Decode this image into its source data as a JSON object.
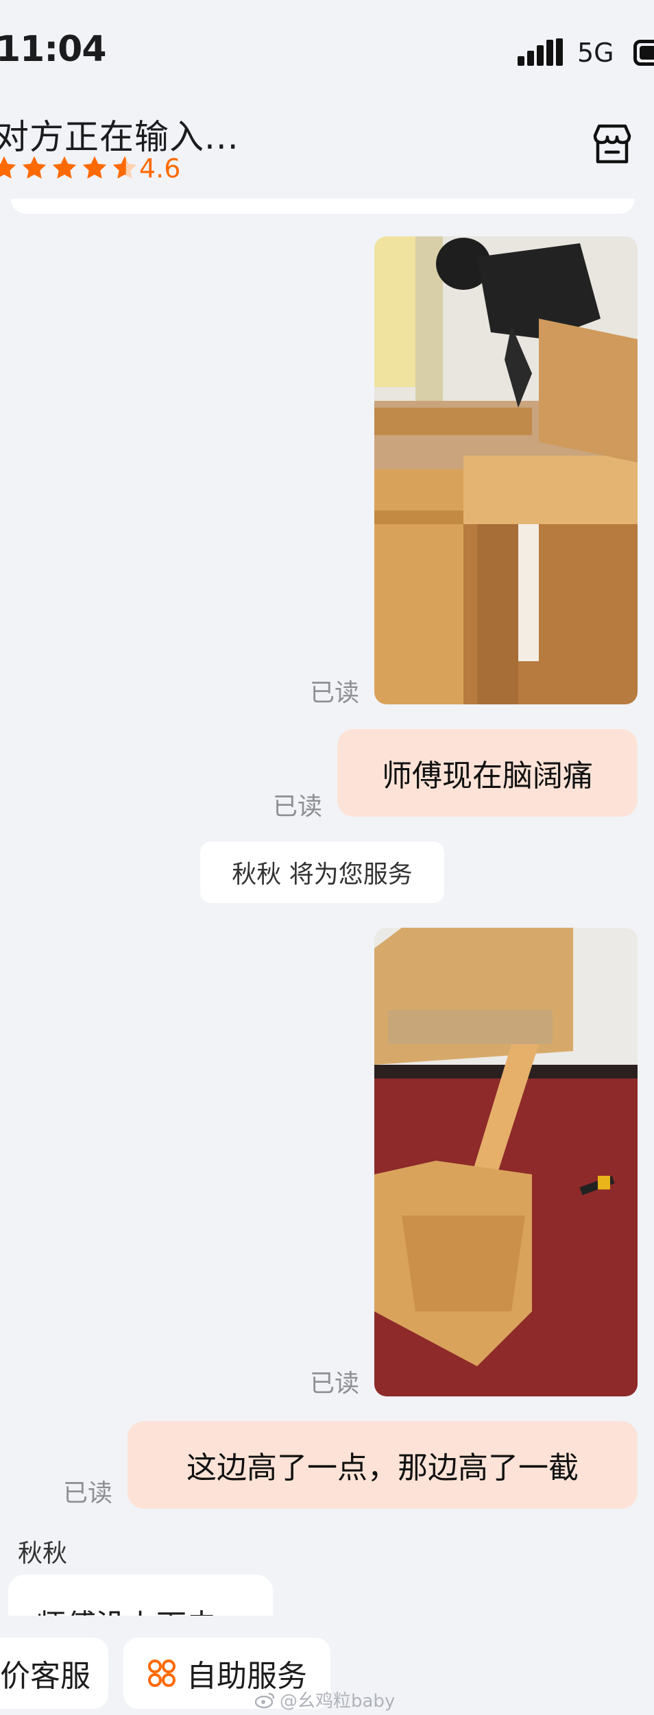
{
  "status_bar": {
    "time": "11:04",
    "network": "5G"
  },
  "header": {
    "title": "对方正在输入...",
    "rating": "4.6",
    "rating_value": 4.6,
    "rating_max": 5
  },
  "messages": {
    "read_label": "已读",
    "bubble1": "师傅现在脑阔痛",
    "system_note": "秋秋 将为您服务",
    "bubble2": "这边高了一点，那边高了一截",
    "sender": "秋秋",
    "incoming_partial": "师傅没上下去"
  },
  "bottom": {
    "left_button": "价客服",
    "self_service_button": "自助服务"
  },
  "watermark": "@幺鸡粒baby",
  "colors": {
    "background": "#f1f3f7",
    "outgoing_bubble": "#fde3d7",
    "accent": "#ff6a00",
    "read_text": "#8e8e93"
  },
  "icons": [
    "star-icon",
    "store-icon",
    "grid-icon",
    "weibo-icon"
  ]
}
